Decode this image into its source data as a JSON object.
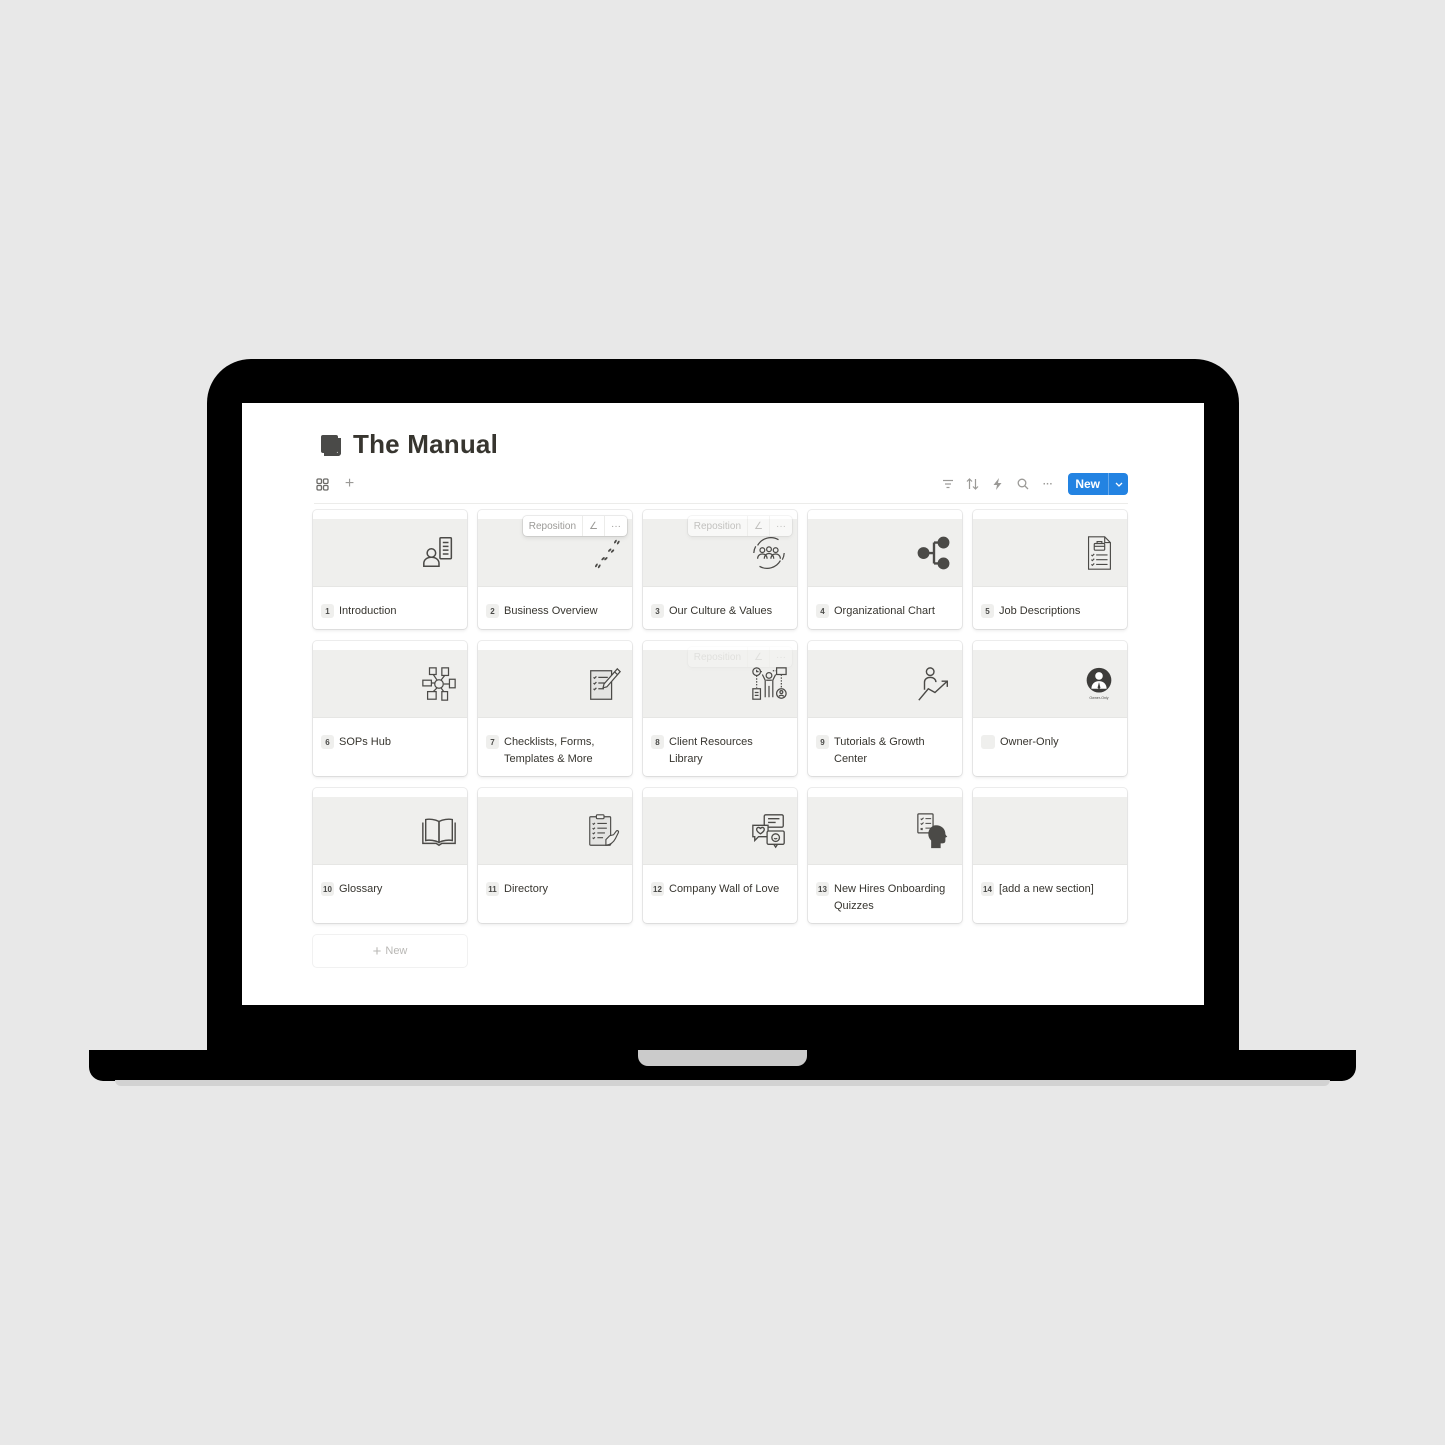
{
  "page": {
    "icon": "book-icon",
    "title": "The Manual"
  },
  "toolbar": {
    "left": [
      {
        "name": "gallery-view-icon",
        "glyph": "⊞"
      },
      {
        "name": "add-view-icon",
        "glyph": "+"
      }
    ],
    "right": [
      {
        "name": "filter-icon",
        "glyph": "≡"
      },
      {
        "name": "sort-icon",
        "glyph": "⇅"
      },
      {
        "name": "automation-icon",
        "glyph": "⚡"
      },
      {
        "name": "search-icon",
        "glyph": "⌕"
      },
      {
        "name": "more-icon",
        "glyph": "···"
      }
    ],
    "new_label": "New",
    "new_chevron": "⌄"
  },
  "hover_bar": {
    "reposition_label": "Reposition",
    "edit_glyph": "∠",
    "more_glyph": "···"
  },
  "cards": [
    {
      "num": "1",
      "title": "Introduction",
      "icon": "person-document-icon"
    },
    {
      "num": "2",
      "title": "Business Overview",
      "icon": "footprints-icon"
    },
    {
      "num": "3",
      "title": "Our Culture & Values",
      "icon": "team-cycle-icon"
    },
    {
      "num": "4",
      "title": "Organizational Chart",
      "icon": "org-chart-icon"
    },
    {
      "num": "5",
      "title": "Job Descriptions",
      "icon": "job-document-icon"
    },
    {
      "num": "6",
      "title": "SOPs Hub",
      "icon": "process-hub-icon"
    },
    {
      "num": "7",
      "title": "Checklists, Forms, Templates & More",
      "icon": "checklist-pen-icon"
    },
    {
      "num": "8",
      "title": "Client Resources Library",
      "icon": "client-resources-icon"
    },
    {
      "num": "9",
      "title": "Tutorials & Growth Center",
      "icon": "growth-person-icon"
    },
    {
      "num": "",
      "title": "Owner-Only",
      "icon": "owner-avatar-icon",
      "icon_caption": "Owner-Only"
    },
    {
      "num": "10",
      "title": "Glossary",
      "icon": "open-book-icon"
    },
    {
      "num": "11",
      "title": "Directory",
      "icon": "clipboard-hand-icon"
    },
    {
      "num": "12",
      "title": "Company Wall of Love",
      "icon": "chat-bubbles-heart-icon"
    },
    {
      "num": "13",
      "title": "New Hires Onboarding Quizzes",
      "icon": "quiz-head-icon"
    },
    {
      "num": "14",
      "title": "[add a new section]",
      "icon": ""
    }
  ],
  "add_new": {
    "plus": "+",
    "label": "New"
  }
}
